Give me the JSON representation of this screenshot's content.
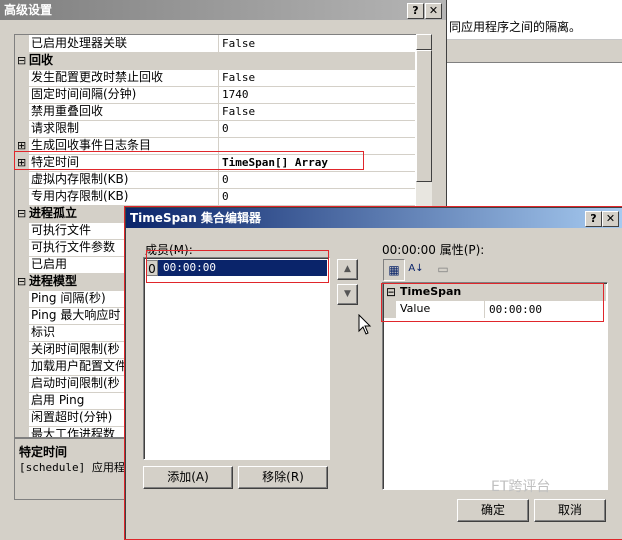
{
  "background_app": {
    "text": "同应用程序之间的隔离。"
  },
  "advanced_dialog": {
    "title": "高级设置",
    "help_label": "?",
    "close_label": "✕",
    "rows": [
      {
        "type": "prop",
        "name": "已启用处理器关联",
        "value": "False"
      },
      {
        "type": "cat",
        "name": "回收",
        "toggle": "⊟"
      },
      {
        "type": "prop",
        "name": "发生配置更改时禁止回收",
        "value": "False"
      },
      {
        "type": "prop",
        "name": "固定时间间隔(分钟)",
        "value": "1740"
      },
      {
        "type": "prop",
        "name": "禁用重叠回收",
        "value": "False"
      },
      {
        "type": "prop",
        "name": "请求限制",
        "value": "0"
      },
      {
        "type": "prop",
        "name": "生成回收事件日志条目",
        "value": "",
        "toggle": "⊞"
      },
      {
        "type": "prop",
        "name": "特定时间",
        "value": "TimeSpan[] Array",
        "toggle": "⊞"
      },
      {
        "type": "prop",
        "name": "虚拟内存限制(KB)",
        "value": "0"
      },
      {
        "type": "prop",
        "name": "专用内存限制(KB)",
        "value": "0"
      },
      {
        "type": "cat",
        "name": "进程孤立",
        "toggle": "⊟"
      },
      {
        "type": "prop",
        "name": "可执行文件",
        "value": ""
      },
      {
        "type": "prop",
        "name": "可执行文件参数",
        "value": ""
      },
      {
        "type": "prop",
        "name": "已启用",
        "value": ""
      },
      {
        "type": "cat",
        "name": "进程模型",
        "toggle": "⊟"
      },
      {
        "type": "prop",
        "name": "Ping 间隔(秒)",
        "value": ""
      },
      {
        "type": "prop",
        "name": "Ping 最大响应时",
        "value": ""
      },
      {
        "type": "prop",
        "name": "标识",
        "value": ""
      },
      {
        "type": "prop",
        "name": "关闭时间限制(秒",
        "value": ""
      },
      {
        "type": "prop",
        "name": "加载用户配置文件",
        "value": ""
      },
      {
        "type": "prop",
        "name": "启动时间限制(秒",
        "value": ""
      },
      {
        "type": "prop",
        "name": "启用 Ping",
        "value": ""
      },
      {
        "type": "prop",
        "name": "闲置超时(分钟)",
        "value": ""
      },
      {
        "type": "prop",
        "name": "最大工作进程数",
        "value": ""
      }
    ],
    "description": {
      "title": "特定时间",
      "text": "[schedule] 应用程"
    }
  },
  "collection_editor": {
    "title": "TimeSpan 集合编辑器",
    "help_label": "?",
    "close_label": "✕",
    "members_label": "成员(M):",
    "members": [
      {
        "index": "0",
        "value": "00:00:00"
      }
    ],
    "properties_label": "00:00:00 属性(P):",
    "up_arrow": "▲",
    "down_arrow": "▼",
    "category_icon": "▦",
    "alpha_sort": "A↓",
    "property_pages_icon": "▭",
    "grid_toggle": "⊟",
    "grid_category": "TimeSpan",
    "grid_rows": [
      {
        "name": "Value",
        "value": "00:00:00"
      }
    ],
    "add_label": "添加(A)",
    "remove_label": "移除(R)",
    "ok_label": "确定",
    "cancel_label": "取消",
    "watermark": "ET跨评台"
  },
  "colors": {
    "highlight": "#0a246a",
    "annotation": "#e0262b"
  }
}
